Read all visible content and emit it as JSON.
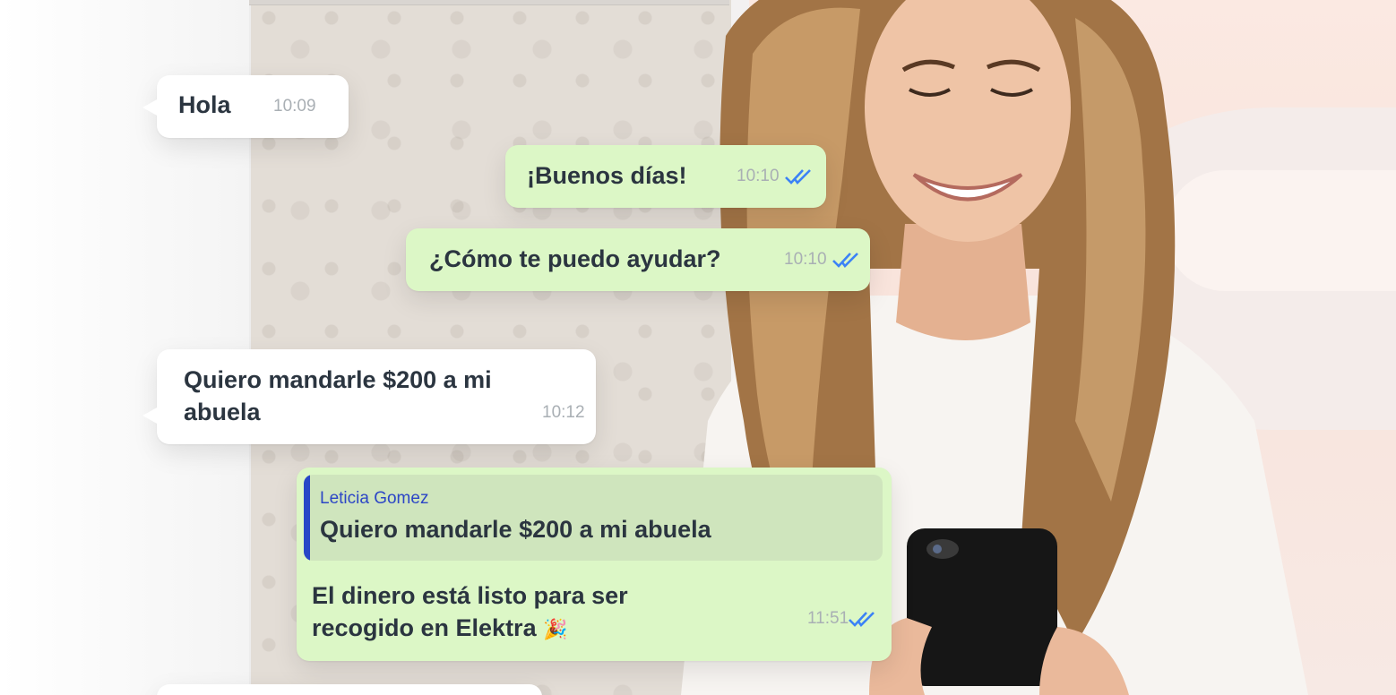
{
  "colors": {
    "incoming_bubble": "#ffffff",
    "outgoing_bubble": "#dcf7c6",
    "read_ticks": "#3b82f6",
    "quote_accent": "#2847c7",
    "text": "#2b3540",
    "timestamp": "#a9afb4"
  },
  "chat": {
    "messages": [
      {
        "direction": "incoming",
        "text": "Hola",
        "time": "10:09"
      },
      {
        "direction": "outgoing",
        "text": "¡Buenos días!",
        "time": "10:10",
        "status_icon": "double-check-read-icon"
      },
      {
        "direction": "outgoing",
        "text": "¿Cómo te puedo ayudar?",
        "time": "10:10",
        "status_icon": "double-check-read-icon"
      },
      {
        "direction": "incoming",
        "line1": "Quiero mandarle $200 a mi",
        "line2": "abuela",
        "time": "10:12"
      },
      {
        "direction": "outgoing",
        "quote": {
          "author": "Leticia Gomez",
          "text": "Quiero mandarle $200 a mi abuela"
        },
        "line1": "El dinero está listo para ser",
        "line2": "recogido en Elektra",
        "emoji": "🎉",
        "time": "11:51",
        "status_icon": "double-check-read-icon"
      }
    ]
  },
  "photo": {
    "subject": "smiling woman holding smartphone",
    "phone_icon": "smartphone-icon"
  }
}
